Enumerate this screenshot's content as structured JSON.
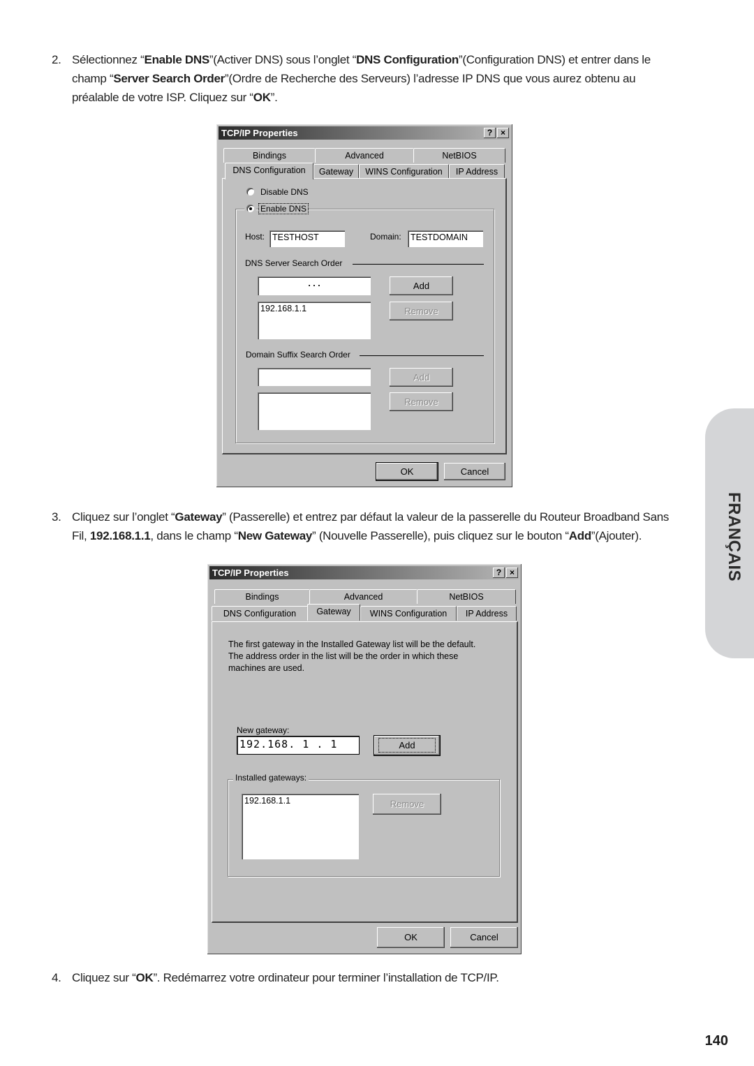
{
  "steps": [
    {
      "number": "2.",
      "segments": [
        {
          "t": "Sélectionnez “",
          "b": false
        },
        {
          "t": "Enable DNS",
          "b": true
        },
        {
          "t": "”(Activer DNS) sous l’onglet “",
          "b": false
        },
        {
          "t": "DNS Configuration",
          "b": true
        },
        {
          "t": "”(Configuration DNS) et entrer dans le champ “",
          "b": false
        },
        {
          "t": "Server Search Order",
          "b": true
        },
        {
          "t": "”(Ordre de Recherche des Serveurs) l’adresse IP DNS que vous aurez obtenu au préalable de votre ISP. Cliquez sur “",
          "b": false
        },
        {
          "t": "OK",
          "b": true
        },
        {
          "t": "”.",
          "b": false
        }
      ]
    },
    {
      "number": "3.",
      "segments": [
        {
          "t": "Cliquez sur l’onglet “",
          "b": false
        },
        {
          "t": "Gateway",
          "b": true
        },
        {
          "t": "” (Passerelle) et entrez par défaut la valeur de la passerelle du Routeur Broadband Sans Fil, ",
          "b": false
        },
        {
          "t": "192.168.1.1",
          "b": true
        },
        {
          "t": ", dans le champ “",
          "b": false
        },
        {
          "t": "New Gateway",
          "b": true
        },
        {
          "t": "” (Nouvelle Passerelle), puis cliquez sur le bouton “",
          "b": false
        },
        {
          "t": "Add",
          "b": true
        },
        {
          "t": "”(Ajouter).",
          "b": false
        }
      ]
    },
    {
      "number": "4.",
      "segments": [
        {
          "t": "Cliquez sur “",
          "b": false
        },
        {
          "t": "OK",
          "b": true
        },
        {
          "t": "”. Redémarrez votre ordinateur pour terminer l’installation de TCP/IP.",
          "b": false
        }
      ]
    }
  ],
  "side_tab": {
    "label": "FRANÇAIS",
    "color": "#d4d5d7"
  },
  "page_number": "140",
  "dialog1": {
    "title": "TCP/IP Properties",
    "help_button": "?",
    "close_button": "×",
    "tabs_row1": [
      "Bindings",
      "Advanced",
      "NetBIOS"
    ],
    "tabs_row2": [
      "DNS Configuration",
      "Gateway",
      "WINS Configuration",
      "IP Address"
    ],
    "active_tab": "DNS Configuration",
    "disable_dns": "Disable DNS",
    "enable_dns": "Enable DNS",
    "enable_dns_checked": true,
    "host_label": "Host:",
    "host_value": "TESTHOST",
    "domain_label": "Domain:",
    "domain_value": "TESTDOMAIN",
    "dns_server_order_label": "DNS Server Search Order",
    "dns_ip_input": ".       .       .",
    "dns_add": "Add",
    "dns_remove": "Remove",
    "dns_list": [
      "192.168.1.1"
    ],
    "suffix_order_label": "Domain Suffix Search Order",
    "suffix_input": "",
    "suffix_add": "Add",
    "suffix_remove": "Remove",
    "ok": "OK",
    "cancel": "Cancel"
  },
  "dialog2": {
    "title": "TCP/IP Properties",
    "help_button": "?",
    "close_button": "×",
    "tabs_row1": [
      "Bindings",
      "Advanced",
      "NetBIOS"
    ],
    "tabs_row2": [
      "DNS Configuration",
      "Gateway",
      "WINS Configuration",
      "IP Address"
    ],
    "active_tab": "Gateway",
    "description": "The first gateway in the Installed Gateway list will be the default. The address order in the list will be the order in which these machines are used.",
    "description_lines": [
      "The first gateway in the Installed Gateway list will be the default.",
      "The address order in the list will be the order in which these",
      "machines are used."
    ],
    "new_gateway_label": "New gateway:",
    "new_gateway_value": "192.168.  1  .  1",
    "add": "Add",
    "installed_label": "Installed gateways:",
    "installed_list": [
      "192.168.1.1"
    ],
    "remove": "Remove",
    "ok": "OK",
    "cancel": "Cancel"
  }
}
